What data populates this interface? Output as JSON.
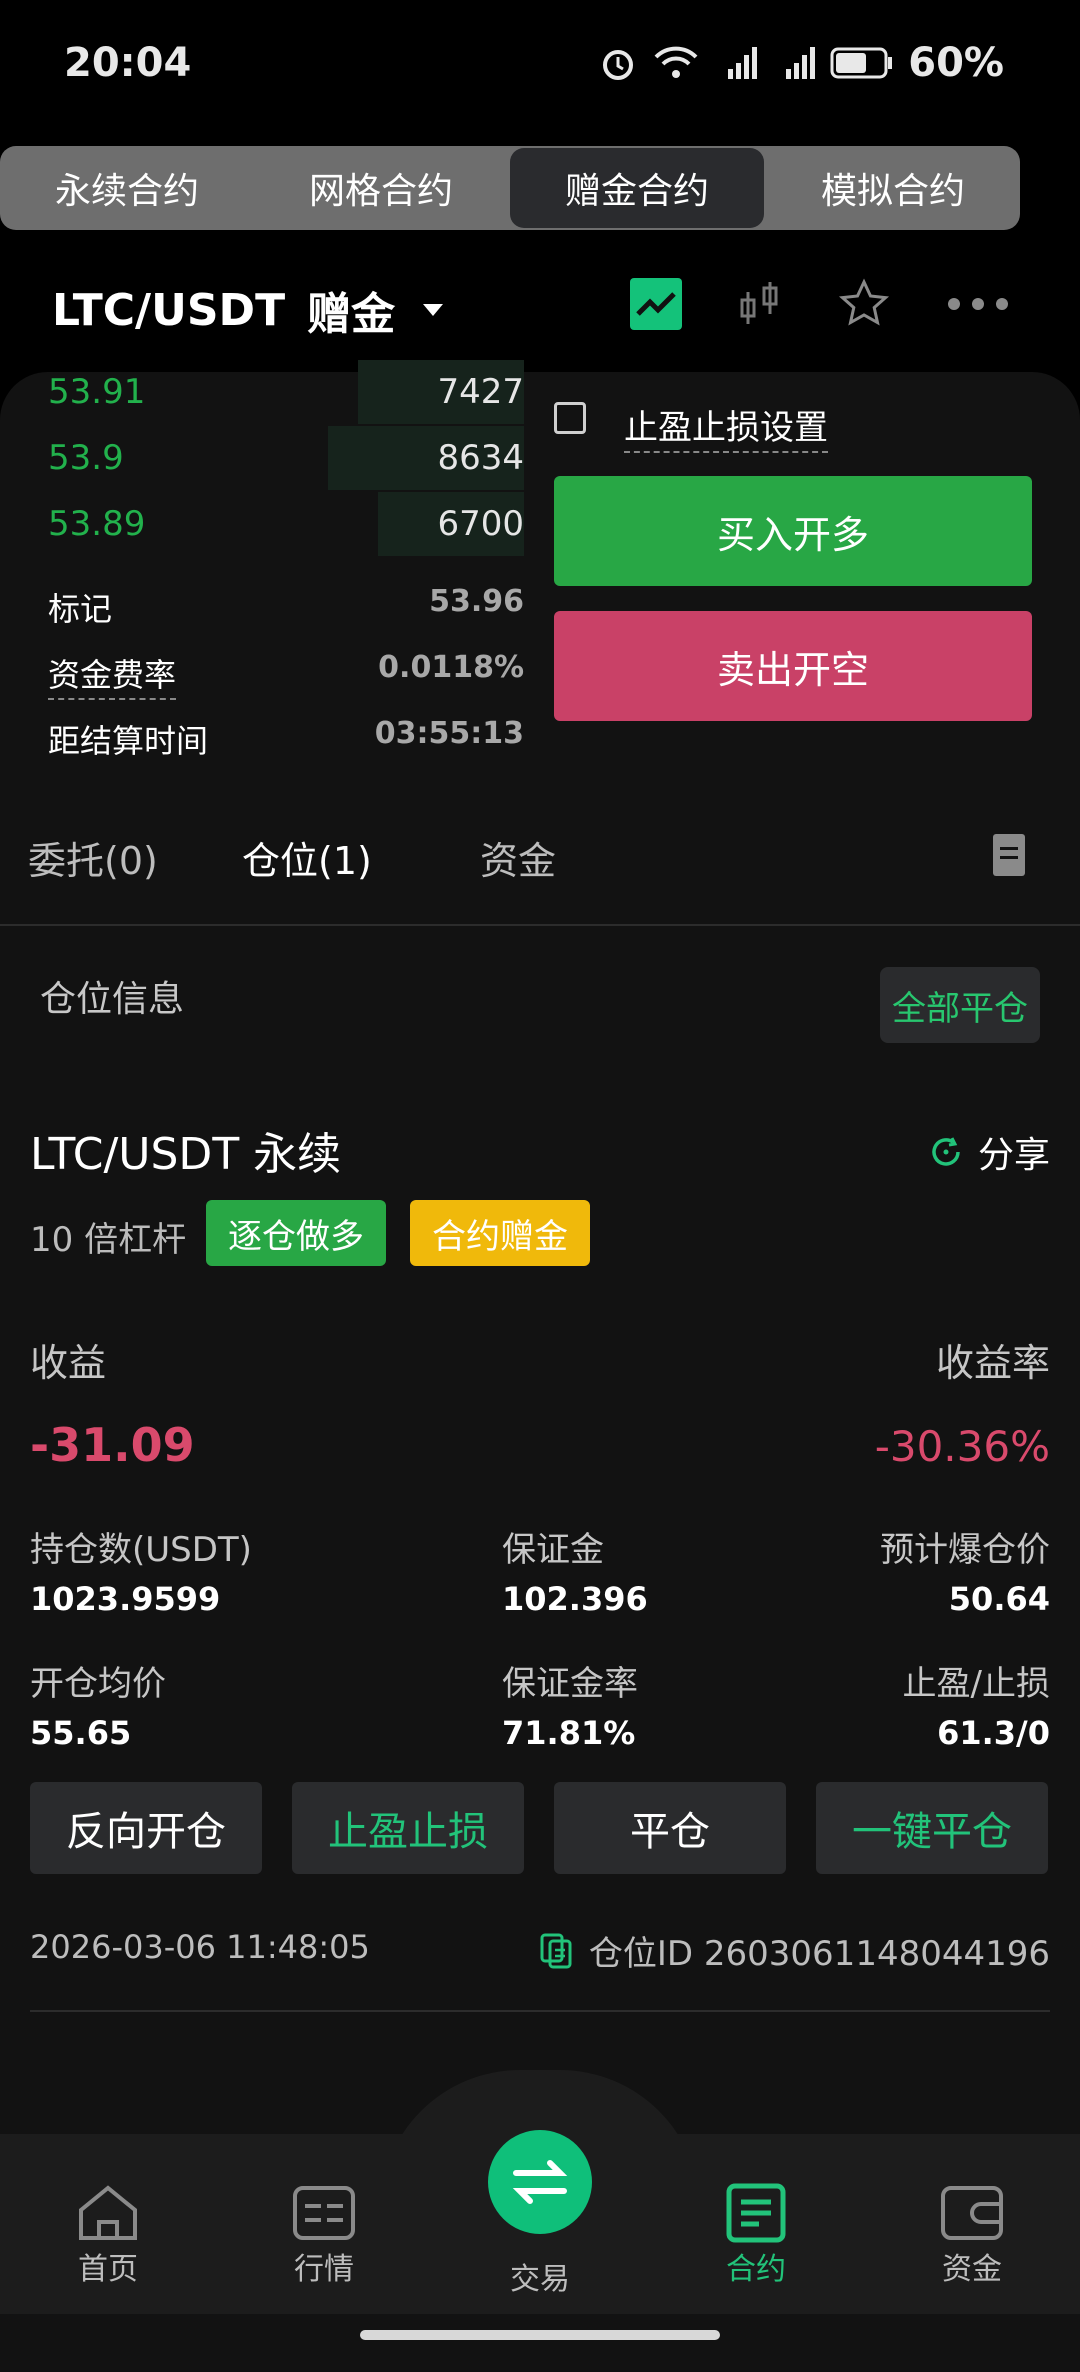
{
  "status": {
    "time": "20:04",
    "battery": "60%"
  },
  "tabs": [
    "永续合约",
    "网格合约",
    "赠金合约",
    "模拟合约"
  ],
  "header": {
    "pair": "LTC/USDT",
    "tag": "赠金"
  },
  "orderbook": [
    {
      "price": "53.91",
      "qty": "7427",
      "depth": 0.45
    },
    {
      "price": "53.9",
      "qty": "8634",
      "depth": 0.53
    },
    {
      "price": "53.89",
      "qty": "6700",
      "depth": 0.4
    }
  ],
  "info": {
    "mark_label": "标记",
    "mark_value": "53.96",
    "funding_label": "资金费率",
    "funding_value": "0.0118%",
    "settle_label": "距结算时间",
    "settle_value": "03:55:13"
  },
  "tpsl_checkbox_label": "止盈止损设置",
  "buttons": {
    "long": "买入开多",
    "short": "卖出开空"
  },
  "subtabs": [
    "委托(0)",
    "仓位(1)",
    "资金"
  ],
  "position_section": {
    "title": "仓位信息",
    "close_all": "全部平仓"
  },
  "position": {
    "pair": "LTC/USDT 永续",
    "share": "分享",
    "leverage": "10 倍杠杆",
    "badge_mode": "逐仓做多",
    "badge_bonus": "合约赠金",
    "pnl_label": "收益",
    "pnl_value": "-31.09",
    "roi_label": "收益率",
    "roi_value": "-30.36%",
    "size_label": "持仓数(USDT)",
    "size_value": "1023.9599",
    "margin_label": "保证金",
    "margin_value": "102.396",
    "liq_label": "预计爆仓价",
    "liq_value": "50.64",
    "entry_label": "开仓均价",
    "entry_value": "55.65",
    "margin_rate_label": "保证金率",
    "margin_rate_value": "71.81%",
    "tpsl_label": "止盈/止损",
    "tpsl_value": "61.3/0",
    "actions": {
      "reverse": "反向开仓",
      "tpsl": "止盈止损",
      "close": "平仓",
      "quick_close": "一键平仓"
    },
    "timestamp": "2026-03-06 11:48:05",
    "position_id": "仓位ID 2603061148044196"
  },
  "nav": [
    "首页",
    "行情",
    "交易",
    "合约",
    "资金"
  ],
  "colors": {
    "green": "#28a745",
    "red": "#c94167",
    "accent": "#22c37a",
    "bonus": "#f0b90b"
  }
}
